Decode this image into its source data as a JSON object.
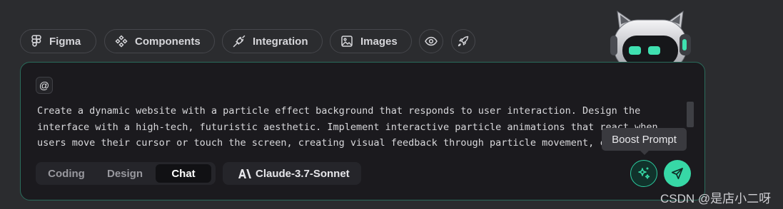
{
  "toolbar": {
    "chips": [
      {
        "label": "Figma",
        "icon": "figma-icon"
      },
      {
        "label": "Components",
        "icon": "components-icon"
      },
      {
        "label": "Integration",
        "icon": "plug-icon"
      },
      {
        "label": "Images",
        "icon": "image-icon"
      }
    ],
    "icon_buttons": [
      "eye-icon",
      "rocket-icon"
    ]
  },
  "composer": {
    "mention_symbol": "@",
    "prompt_text": "Create a dynamic website with a particle effect background that responds to user interaction. Design the interface with a high-tech, futuristic aesthetic. Implement interactive particle animations that react when users move their cursor or touch the screen, creating visual feedback through particle movement, color changes"
  },
  "modes": [
    {
      "label": "Coding",
      "active": false
    },
    {
      "label": "Design",
      "active": false
    },
    {
      "label": "Chat",
      "active": true
    }
  ],
  "model": {
    "label": "Claude-3.7-Sonnet",
    "icon": "anthropic-logo-icon"
  },
  "tooltip": {
    "text": "Boost Prompt"
  },
  "actions": {
    "boost_icon": "sparkles-icon",
    "send_icon": "send-icon"
  },
  "watermark": {
    "text": "CSDN @是店小二呀"
  },
  "colors": {
    "accent": "#37d8a6",
    "panel_border": "#2a6c5b",
    "background": "#2b2c2f",
    "panel": "#1b1a1e"
  }
}
